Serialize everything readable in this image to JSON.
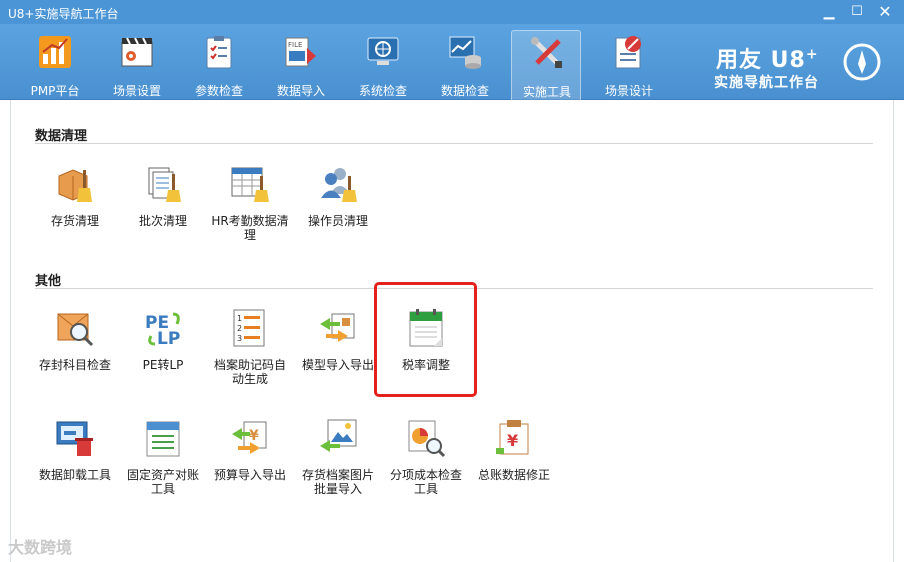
{
  "window": {
    "title": "U8+实施导航工作台"
  },
  "ribbon": {
    "tabs": [
      {
        "label": "PMP平台",
        "icon": "chart-icon"
      },
      {
        "label": "场景设置",
        "icon": "clapper-gear-icon"
      },
      {
        "label": "参数检查",
        "icon": "clipboard-check-icon"
      },
      {
        "label": "数据导入",
        "icon": "file-import-icon"
      },
      {
        "label": "系统检查",
        "icon": "monitor-icon"
      },
      {
        "label": "数据检查",
        "icon": "database-icon"
      },
      {
        "label": "实施工具",
        "icon": "tools-icon"
      },
      {
        "label": "场景设计",
        "icon": "design-icon"
      }
    ],
    "active": "实施工具"
  },
  "brand": {
    "line1": "用友 U8",
    "plus": "+",
    "line2": "实施导航工作台"
  },
  "sections": {
    "cleanup": {
      "title": "数据清理",
      "items": [
        {
          "label": "存货清理",
          "icon": "inventory-broom-icon"
        },
        {
          "label": "批次清理",
          "icon": "batch-broom-icon"
        },
        {
          "label": "HR考勤数据清理",
          "icon": "hr-attendance-broom-icon"
        },
        {
          "label": "操作员清理",
          "icon": "operator-broom-icon"
        }
      ]
    },
    "other": {
      "title": "其他",
      "items": [
        {
          "label": "存封科目检查",
          "icon": "envelope-search-icon"
        },
        {
          "label": "PE转LP",
          "icon": "pe-lp-icon"
        },
        {
          "label": "档案助记码自动生成",
          "icon": "numbered-list-icon"
        },
        {
          "label": "模型导入导出",
          "icon": "model-transfer-icon"
        },
        {
          "label": "税率调整",
          "icon": "tax-calendar-icon"
        },
        {
          "label": "数据卸载工具",
          "icon": "data-unload-icon"
        },
        {
          "label": "固定资产对账工具",
          "icon": "asset-reconcile-icon"
        },
        {
          "label": "预算导入导出",
          "icon": "budget-transfer-icon"
        },
        {
          "label": "存货档案图片批量导入",
          "icon": "image-import-icon"
        },
        {
          "label": "分项成本检查工具",
          "icon": "cost-check-icon"
        },
        {
          "label": "总账数据修正",
          "icon": "ledger-fix-icon"
        }
      ]
    }
  },
  "watermark": "大数跨境"
}
